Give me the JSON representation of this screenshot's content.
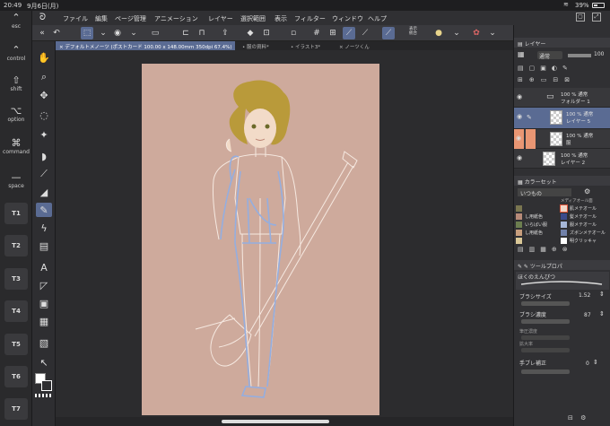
{
  "status": {
    "time": "20:49",
    "date": "9月6日(月)",
    "battery": "39%"
  },
  "modifiers": [
    {
      "glyph": "⌃",
      "label": "esc"
    },
    {
      "glyph": "⌃",
      "label": "control"
    },
    {
      "glyph": "⇧",
      "label": "shift"
    },
    {
      "glyph": "⌥",
      "label": "option"
    },
    {
      "glyph": "⌘",
      "label": "command"
    },
    {
      "glyph": "—",
      "label": "space"
    }
  ],
  "t_buttons": [
    "T1",
    "T2",
    "T3",
    "T4",
    "T5",
    "T6",
    "T7"
  ],
  "menu": [
    "ファイル",
    "編集",
    "ページ管理",
    "アニメーション",
    "レイヤー",
    "選択範囲",
    "表示",
    "フィルター",
    "ウィンドウ",
    "ヘルプ"
  ],
  "cmdbar": {
    "display_label": "表示\n統合"
  },
  "tabs": [
    {
      "label": "× デフォルトメノーツ (ポストカード 100.00 x 148.00mm 350dpi 67.4%)"
    },
    {
      "label": "• 服の資料*"
    },
    {
      "label": "• イラスト3*"
    },
    {
      "label": "× ノーツくん"
    }
  ],
  "layer_panel": {
    "title": "レイヤー",
    "blend_mode": "通常",
    "opacity": "100",
    "layers": [
      {
        "line1": "100 % 通常",
        "line2": "フォルダー 1"
      },
      {
        "line1": "100 % 通常",
        "line2": "レイヤー 5"
      },
      {
        "line1": "100 % 通常",
        "line2": "服"
      },
      {
        "line1": "100 % 通常",
        "line2": "レイヤー 2"
      }
    ]
  },
  "color_set": {
    "title": "カラーセット",
    "set_name": "いつもの",
    "header": "メディアオール面",
    "rows": [
      {
        "left": "",
        "right": "肌メテオール",
        "lc": "#7a7650",
        "rc": "#f1d7c8"
      },
      {
        "left": "し用紙色",
        "right": "髪メテオール",
        "lc": "#b78a78",
        "rc": "#3b4a8a"
      },
      {
        "left": "いらばい服",
        "right": "服メテオール",
        "lc": "#6c7e4f",
        "rc": "#a6b7d8"
      },
      {
        "left": "し用紙色",
        "right": "ズボンメテオール",
        "lc": "#c79e7d",
        "rc": "#7181a9"
      },
      {
        "left": "",
        "right": "明クリッキャ",
        "lc": "#d9c797",
        "rc": "#ffffff"
      }
    ]
  },
  "tool_property": {
    "title": "ツールプロパ",
    "brush_name": "ほくのえんぴつ",
    "brush_size_label": "ブラシサイズ",
    "brush_size": "1.52",
    "brush_density_label": "ブラシ濃度",
    "brush_density": "87",
    "fade_label": "筆圧濃度",
    "enlarge_label": "拡大率",
    "stabilization_label": "手ブレ補正",
    "stabilization": "0"
  },
  "colors": {
    "paper": "#ceaa9c",
    "hair": "#b99a3a",
    "sketch_blue": "#94aee0",
    "sketch_white": "#f6e9e1",
    "accent": "#5a6b93",
    "skin": "#f2dbc8"
  }
}
